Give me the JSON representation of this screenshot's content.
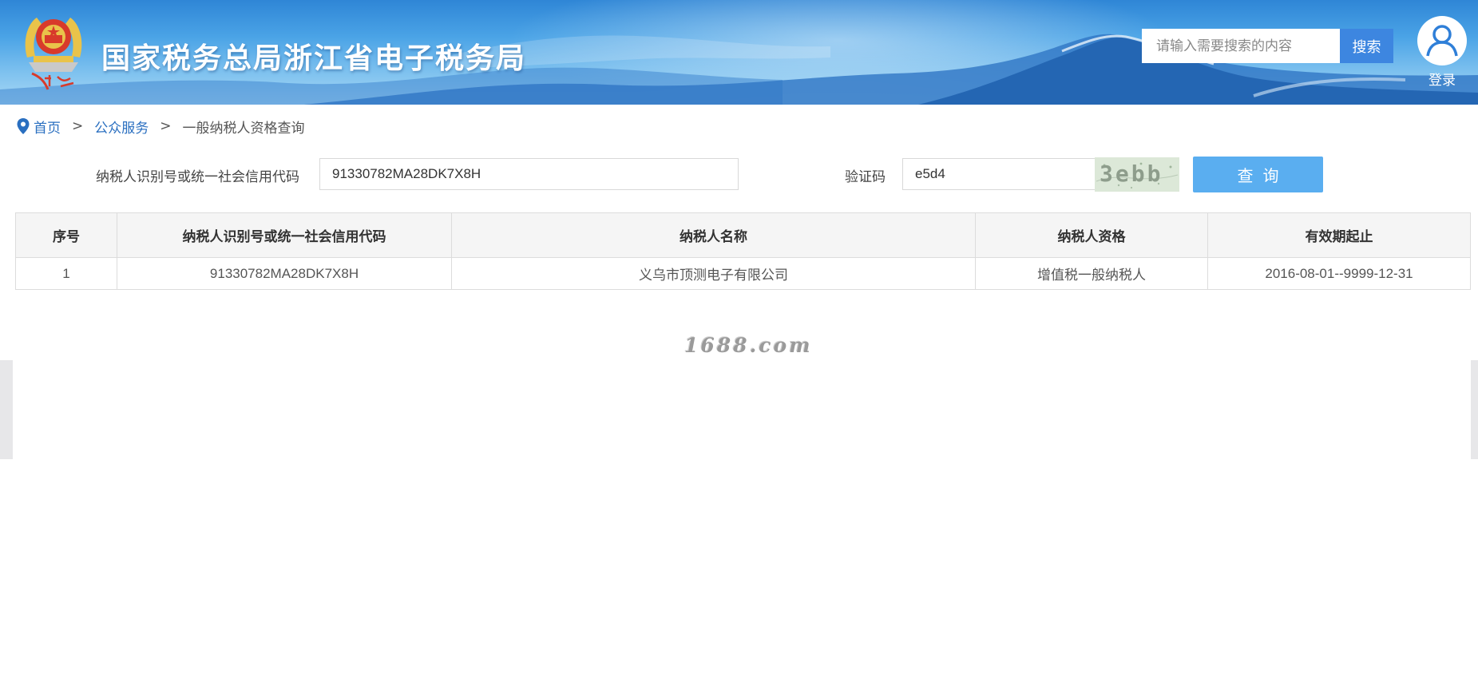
{
  "header": {
    "site_title": "国家税务总局浙江省电子税务局",
    "emblem_caption": "中国税务",
    "search": {
      "placeholder": "请输入需要搜索的内容",
      "value": "",
      "button_label": "搜索"
    },
    "login_label": "登录"
  },
  "breadcrumb": {
    "icon": "location-pin-icon",
    "items": [
      "首页",
      "公众服务"
    ],
    "separator": ">",
    "current": "一般纳税人资格查询"
  },
  "query_form": {
    "taxpayer_id_label": "纳税人识别号或统一社会信用代码",
    "taxpayer_id_value": "91330782MA28DK7X8H",
    "captcha_label": "验证码",
    "captcha_value": "e5d4",
    "captcha_image_text": "3ebb",
    "submit_label": "查询"
  },
  "results_table": {
    "headers": [
      "序号",
      "纳税人识别号或统一社会信用代码",
      "纳税人名称",
      "纳税人资格",
      "有效期起止"
    ],
    "rows": [
      [
        "1",
        "91330782MA28DK7X8H",
        "义乌市顶测电子有限公司",
        "增值税一般纳税人",
        "2016-08-01--9999-12-31"
      ]
    ]
  },
  "watermark": "1688.com",
  "colors": {
    "primary_blue": "#3d86e0",
    "query_button": "#5aaef0",
    "link_blue": "#2a6fc0",
    "table_header_bg": "#f5f5f5"
  }
}
